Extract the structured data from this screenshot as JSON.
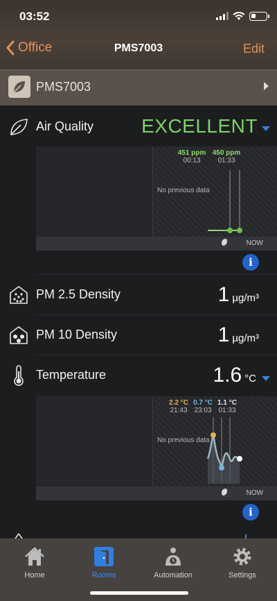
{
  "status_bar": {
    "time": "03:52"
  },
  "nav": {
    "back_label": "Office",
    "title": "PMS7003",
    "edit_label": "Edit"
  },
  "device": {
    "name": "PMS7003"
  },
  "air_quality": {
    "label": "Air Quality",
    "status": "EXCELLENT",
    "status_color": "#7ed26a",
    "graph": {
      "no_data": "No previous data",
      "points": [
        {
          "value": "451 ppm",
          "time": "00:13"
        },
        {
          "value": "450 ppm",
          "time": "01:33"
        }
      ],
      "now_label": "NOW"
    }
  },
  "pm25": {
    "label": "PM 2.5 Density",
    "value": "1",
    "unit": "µg/m³"
  },
  "pm10": {
    "label": "PM 10 Density",
    "value": "1",
    "unit": "µg/m³"
  },
  "temperature": {
    "label": "Temperature",
    "value": "1.6",
    "unit": "°C",
    "graph": {
      "no_data": "No previous data",
      "points": [
        {
          "value": "2.2 °C",
          "time": "21:43",
          "color": "#e0b25a"
        },
        {
          "value": "0.7 °C",
          "time": "23:03",
          "color": "#6fb6dc"
        },
        {
          "value": "1.1 °C",
          "time": "01:33",
          "color": "#e6e6e6"
        }
      ],
      "now_label": "NOW"
    }
  },
  "tabs": [
    {
      "label": "Home",
      "icon": "home-icon",
      "active": false
    },
    {
      "label": "Rooms",
      "icon": "rooms-icon",
      "active": true
    },
    {
      "label": "Automation",
      "icon": "automation-icon",
      "active": false
    },
    {
      "label": "Settings",
      "icon": "settings-icon",
      "active": false
    }
  ],
  "colors": {
    "accent": "#e4935a",
    "active_tab": "#3a8ef0",
    "info": "#2463c8"
  }
}
